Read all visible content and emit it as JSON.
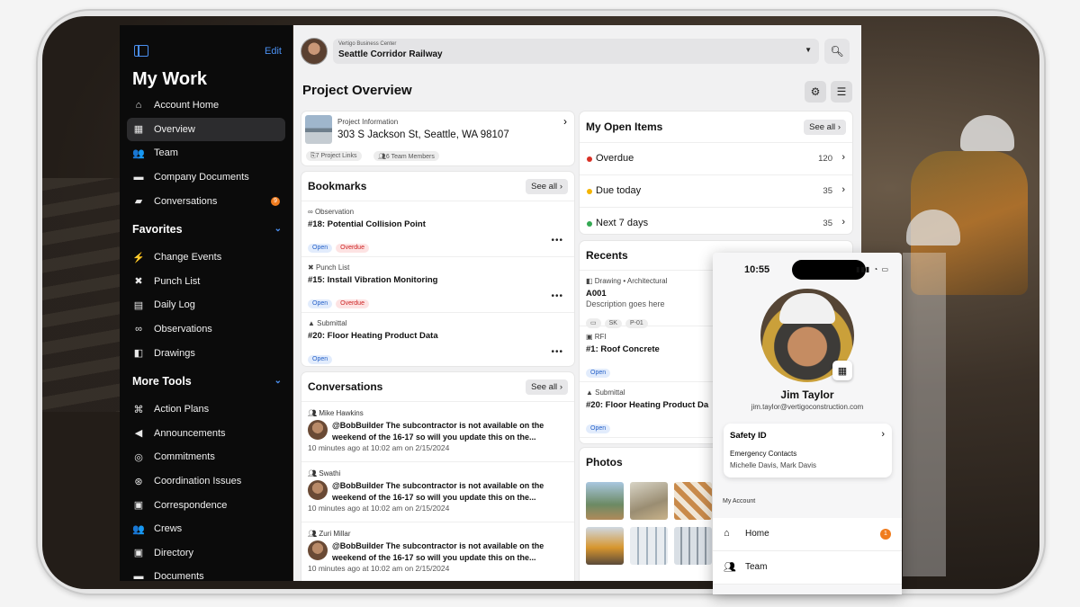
{
  "sidebar": {
    "edit_label": "Edit",
    "title": "My Work",
    "items": [
      {
        "icon": "home-icon",
        "glyph": "⌂",
        "label": "Account Home"
      },
      {
        "icon": "building-icon",
        "glyph": "▦",
        "label": "Overview",
        "active": true
      },
      {
        "icon": "team-icon",
        "glyph": "👥",
        "label": "Team"
      },
      {
        "icon": "folder-icon",
        "glyph": "▬",
        "label": "Company Documents"
      },
      {
        "icon": "chat-icon",
        "glyph": "▰",
        "label": "Conversations",
        "badge": "9"
      }
    ],
    "favorites_label": "Favorites",
    "favorites": [
      {
        "icon": "change-events-icon",
        "glyph": "⚡",
        "label": "Change Events"
      },
      {
        "icon": "pin-icon",
        "glyph": "✖",
        "label": "Punch List"
      },
      {
        "icon": "daily-log-icon",
        "glyph": "▤",
        "label": "Daily Log"
      },
      {
        "icon": "binoculars-icon",
        "glyph": "∞",
        "label": "Observations"
      },
      {
        "icon": "drawings-icon",
        "glyph": "◧",
        "label": "Drawings"
      }
    ],
    "more_tools_label": "More Tools",
    "more_tools": [
      {
        "icon": "action-plans-icon",
        "glyph": "⌘",
        "label": "Action Plans"
      },
      {
        "icon": "megaphone-icon",
        "glyph": "◀",
        "label": "Announcements"
      },
      {
        "icon": "handshake-icon",
        "glyph": "◎",
        "label": "Commitments"
      },
      {
        "icon": "coordination-icon",
        "glyph": "⊛",
        "label": "Coordination Issues"
      },
      {
        "icon": "correspondence-icon",
        "glyph": "▣",
        "label": "Correspondence"
      },
      {
        "icon": "crews-icon",
        "glyph": "👥",
        "label": "Crews"
      },
      {
        "icon": "directory-icon",
        "glyph": "▣",
        "label": "Directory"
      },
      {
        "icon": "documents-icon",
        "glyph": "▬",
        "label": "Documents"
      }
    ]
  },
  "topbar": {
    "company": "Vertigo Business Center",
    "project": "Seattle Corridor Railway"
  },
  "page_title": "Project Overview",
  "project_info": {
    "label": "Project Information",
    "address": "303 S Jackson St, Seattle, WA 98107",
    "links": "7 Project Links",
    "members": "6 Team Members"
  },
  "bookmarks": {
    "title": "Bookmarks",
    "see_all": "See all",
    "items": [
      {
        "kind": "Observation",
        "title": "#18: Potential Collision Point",
        "tags": [
          "Open",
          "Overdue"
        ]
      },
      {
        "kind": "Punch List",
        "title": "#15: Install Vibration Monitoring",
        "tags": [
          "Open",
          "Overdue"
        ]
      },
      {
        "kind": "Submittal",
        "title": "#20: Floor Heating Product Data",
        "tags": [
          "Open"
        ]
      }
    ]
  },
  "conversations": {
    "title": "Conversations",
    "see_all": "See all",
    "items": [
      {
        "name": "Mike Hawkins",
        "message": "@BobBuilder The subcontractor is not available on the weekend of the 16-17 so will you update this on the...",
        "time": "10 minutes ago at 10:02 am on 2/15/2024"
      },
      {
        "name": "Swathi",
        "message": "@BobBuilder The subcontractor is not available on the weekend of the 16-17 so will you update this on the...",
        "time": "10 minutes ago at 10:02 am on 2/15/2024"
      },
      {
        "name": "Zuri Millar",
        "message": "@BobBuilder The subcontractor is not available on the weekend of the 16-17 so will you update this on the...",
        "time": "10 minutes ago at 10:02 am on 2/15/2024"
      }
    ]
  },
  "open_items": {
    "title": "My Open Items",
    "see_all": "See all",
    "rows": [
      {
        "label": "Overdue",
        "count": "120",
        "color": "#d93025"
      },
      {
        "label": "Due today",
        "count": "35",
        "color": "#f4b400"
      },
      {
        "label": "Next 7 days",
        "count": "35",
        "color": "#34a853"
      }
    ]
  },
  "recents": {
    "title": "Recents",
    "items": [
      {
        "kind": "Drawing • Architectural",
        "title": "A001",
        "desc": "Description goes here",
        "tags": [
          "SK",
          "P-01"
        ]
      },
      {
        "kind": "RFI",
        "title": "#1: Roof Concrete",
        "tags": [
          "Open"
        ]
      },
      {
        "kind": "Submittal",
        "title": "#20: Floor Heating Product Da",
        "tags": [
          "Open"
        ]
      }
    ]
  },
  "photos": {
    "title": "Photos"
  },
  "phone": {
    "time": "10:55",
    "name": "Jim Taylor",
    "email": "jim.taylor@vertigoconstruction.com",
    "safety_title": "Safety ID",
    "emergency_label": "Emergency Contacts",
    "emergency_names": "Michelle Davis, Mark Davis",
    "account_label": "My Account",
    "menu": [
      {
        "icon": "home-icon",
        "label": "Home",
        "badge": "1"
      },
      {
        "icon": "team-icon",
        "label": "Team"
      }
    ]
  }
}
